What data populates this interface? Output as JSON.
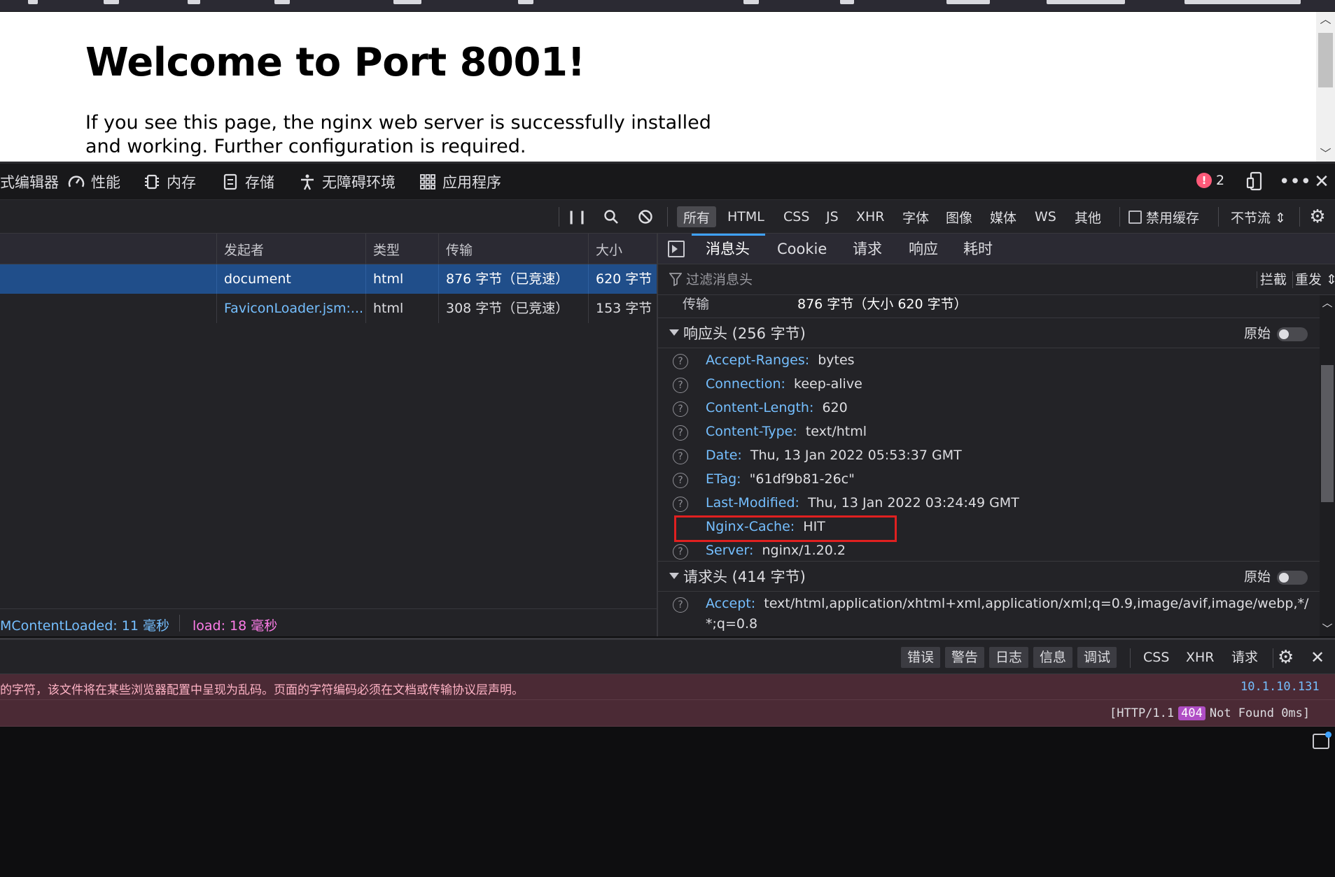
{
  "webpage": {
    "heading": "Welcome to Port 8001!",
    "paragraph": "If you see this page, the nginx web server is successfully installed and working. Further configuration is required."
  },
  "devtools": {
    "tabs": [
      {
        "label": "式编辑器",
        "icon": "style-editor-icon"
      },
      {
        "label": "性能",
        "icon": "performance-gauge-icon"
      },
      {
        "label": "内存",
        "icon": "memory-chip-icon"
      },
      {
        "label": "存储",
        "icon": "storage-icon"
      },
      {
        "label": "无障碍环境",
        "icon": "accessibility-icon"
      },
      {
        "label": "应用程序",
        "icon": "application-grid-icon"
      }
    ],
    "error_count": "2"
  },
  "network_toolbar": {
    "filters": [
      "所有",
      "HTML",
      "CSS",
      "JS",
      "XHR",
      "字体",
      "图像",
      "媒体",
      "WS",
      "其他"
    ],
    "active_filter": "所有",
    "disable_cache_label": "禁用缓存",
    "throttle_label": "不节流 ⇕"
  },
  "request_list": {
    "columns": [
      "发起者",
      "类型",
      "传输",
      "大小"
    ],
    "rows": [
      {
        "initiator": "document",
        "type": "html",
        "transferred": "876 字节（已竞速）",
        "size": "620 字节",
        "selected": true
      },
      {
        "initiator": "FaviconLoader.jsm:...",
        "type": "html",
        "transferred": "308 字节（已竞速）",
        "size": "153 字节",
        "selected": false
      }
    ],
    "footer": {
      "dom_content_loaded": "MContentLoaded: 11 毫秒",
      "load": "load: 18 毫秒"
    }
  },
  "details": {
    "tabs": [
      "消息头",
      "Cookie",
      "请求",
      "响应",
      "耗时"
    ],
    "active_tab": "消息头",
    "filter_placeholder": "过滤消息头",
    "block_label": "拦截",
    "resend_label": "重发 ⇕",
    "transfer_row": {
      "name": "传输",
      "value": "876 字节（大小 620 字节）"
    },
    "response_headers": {
      "title": "响应头 (256 字节)",
      "raw_label": "原始",
      "items": [
        {
          "name": "Accept-Ranges",
          "value": "bytes"
        },
        {
          "name": "Connection",
          "value": "keep-alive"
        },
        {
          "name": "Content-Length",
          "value": "620"
        },
        {
          "name": "Content-Type",
          "value": "text/html"
        },
        {
          "name": "Date",
          "value": "Thu, 13 Jan 2022 05:53:37 GMT"
        },
        {
          "name": "ETag",
          "value": "\"61df9b81-26c\""
        },
        {
          "name": "Last-Modified",
          "value": "Thu, 13 Jan 2022 03:24:49 GMT"
        },
        {
          "name": "Nginx-Cache",
          "value": "HIT"
        },
        {
          "name": "Server",
          "value": "nginx/1.20.2"
        }
      ]
    },
    "request_headers": {
      "title": "请求头 (414 字节)",
      "raw_label": "原始",
      "items": [
        {
          "name": "Accept",
          "value": "text/html,application/xhtml+xml,application/xml;q=0.9,image/avif,image/webp,*/",
          "value_cont": "*;q=0.8"
        }
      ]
    }
  },
  "console": {
    "levels": [
      "错误",
      "警告",
      "日志",
      "信息",
      "调试"
    ],
    "types": [
      "CSS",
      "XHR",
      "请求"
    ],
    "messages": [
      {
        "text": "的字符，该文件将在某些浏览器配置中呈现为乱码。页面的字符编码必须在文档或传输协议层声明。",
        "source": "10.1.10.131"
      },
      {
        "http_prefix": "[HTTP/1.1",
        "status_code": "404",
        "status_text": "Not Found 0ms]"
      }
    ]
  },
  "colors": {
    "selected_row": "#204e8a",
    "header_name": "#75bfff",
    "highlight_box": "#e02020",
    "error_badge": "#ff5a79",
    "status_404": "#b04ec5"
  }
}
